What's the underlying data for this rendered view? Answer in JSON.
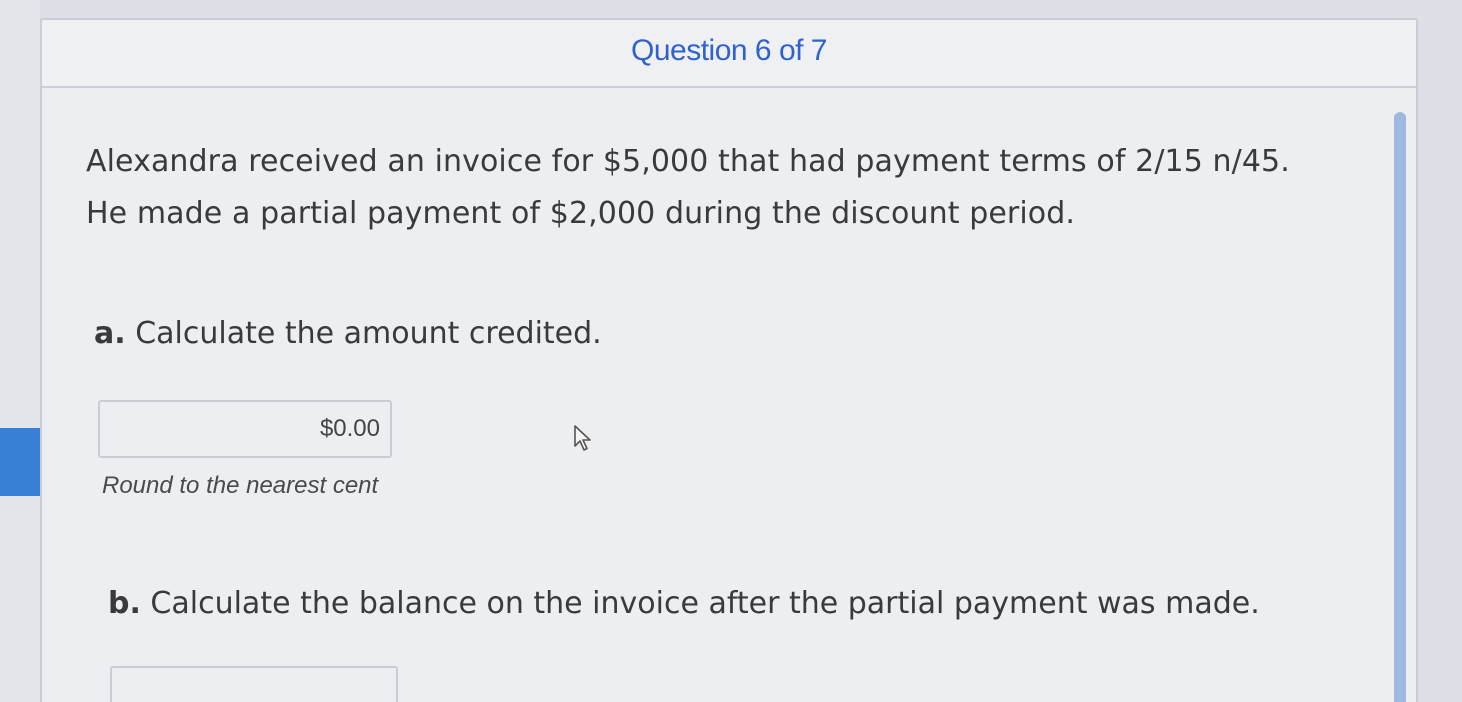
{
  "header": {
    "title": "Question 6 of 7"
  },
  "problem": {
    "text": "Alexandra received an invoice for $5,000 that had payment terms of 2/15 n/45. He made a partial payment of $2,000 during the discount period."
  },
  "part_a": {
    "label": "a.",
    "prompt": "Calculate the amount credited.",
    "answer_value": "$0.00",
    "hint": "Round to the nearest cent"
  },
  "part_b": {
    "label": "b.",
    "prompt": "Calculate the balance on the invoice after the partial payment was made.",
    "answer_value": ""
  },
  "icons": {
    "cursor": "mouse-pointer-icon"
  },
  "colors": {
    "accent": "#2f62d0",
    "side_tab": "#3a7fd6"
  }
}
